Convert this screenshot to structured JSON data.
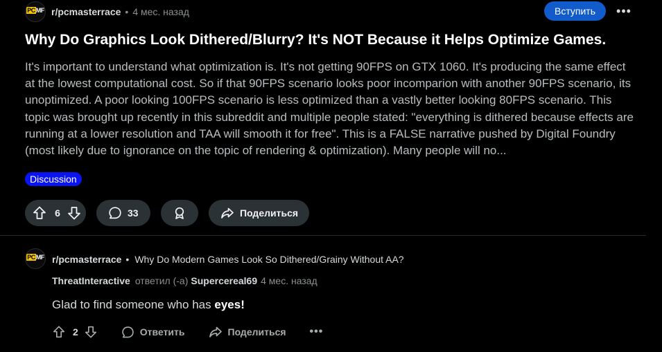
{
  "post": {
    "subreddit": "r/pcmasterrace",
    "separator": "•",
    "age": "4 мес. назад",
    "join_label": "Вступить",
    "more_label": "•••",
    "title": "Why Do Graphics Look Dithered/Blurry? It's NOT Because it Helps Optimize Games.",
    "body": "It's important to understand what optimization is. It's not getting 90FPS on GTX 1060. It's producing the same effect at the lowest computational cost. So if that 90FPS scenario looks poor incomparion with another 90FPS scenario, its unoptimized. A poor looking 100FPS scenario is less optimized than a vastly better looking 80FPS scenario. This topic was brought up recently in this subreddit and multiple people stated: \"everything is dithered because effects are running at a lower resolution and TAA will smooth it for free\". This is a FALSE narrative pushed by Digital Foundry (most likely due to ignorance on the topic of rendering & optimization). Many people will no...",
    "flair": "Discussion",
    "flair_color": "#0a14f0",
    "upvotes": "6",
    "comments": "33",
    "share_label": "Поделиться"
  },
  "avatar": {
    "text_left": "PC",
    "text_right": "MF"
  },
  "comment": {
    "subreddit": "r/pcmasterrace",
    "separator": "•",
    "post_title": "Why Do Modern Games Look So Dithered/Grainy Without AA?",
    "author": "ThreatInteractive",
    "replied_label": "ответил (-а)",
    "replied_to": "Supercereal69",
    "age": "4 мес. назад",
    "text_prefix": "Glad to find someone who has ",
    "text_bold": "eyes!",
    "upvotes": "2",
    "reply_label": "Ответить",
    "share_label": "Поделиться",
    "more_label": "•••"
  },
  "colors": {
    "background": "#000000",
    "accent_button": "#115bca",
    "pill_bg": "#2a3236"
  },
  "icons": {
    "upvote": "arrow-up-icon",
    "downvote": "arrow-down-icon",
    "comment": "speech-bubble-icon",
    "award": "award-icon",
    "share": "share-arrow-icon",
    "more": "ellipsis-icon"
  }
}
